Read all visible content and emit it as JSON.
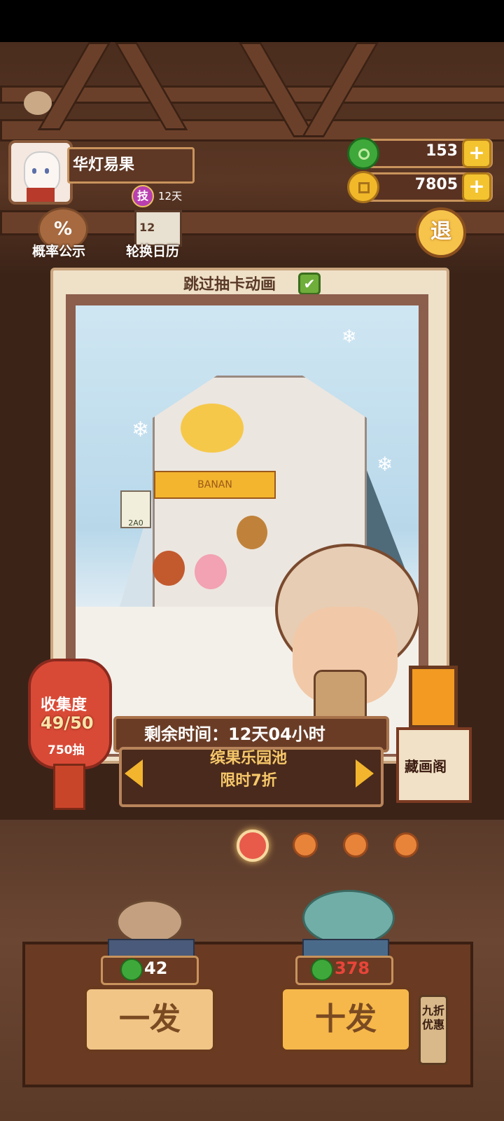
{
  "player": {
    "name": "华灯易果",
    "skill_badge": "技",
    "skill_days": "12天"
  },
  "currency": {
    "jade": "153",
    "coins": "7805",
    "plus": "+"
  },
  "menu": {
    "probability_label": "概率公示",
    "probability_icon": "%",
    "calendar_label": "轮换日历",
    "calendar_number": "12",
    "exit_label": "退"
  },
  "card": {
    "skip_animation_label": "跳过抽卡动画",
    "skip_checked": true,
    "check_mark": "✔",
    "art_sign_text": "BANAN",
    "art_board_text": "2A0"
  },
  "collection": {
    "title": "收集度",
    "count": "49/50",
    "draws": "750抽"
  },
  "pool": {
    "remaining_time": "剩余时间：12天04小时",
    "name": "缤果乐园池",
    "discount": "限时7折"
  },
  "gallery": {
    "label": "藏画阁"
  },
  "pagination": {
    "total": 4,
    "active": 0
  },
  "pulls": {
    "single_label": "一发",
    "single_cost": "42",
    "ten_label": "十发",
    "ten_cost": "378",
    "ten_discount_tag": "九折优惠"
  },
  "colors": {
    "accent_gold": "#f3c430",
    "jade_green": "#3fa83a",
    "cost_red": "#e8453a",
    "frame_brown": "#6a3a22"
  }
}
